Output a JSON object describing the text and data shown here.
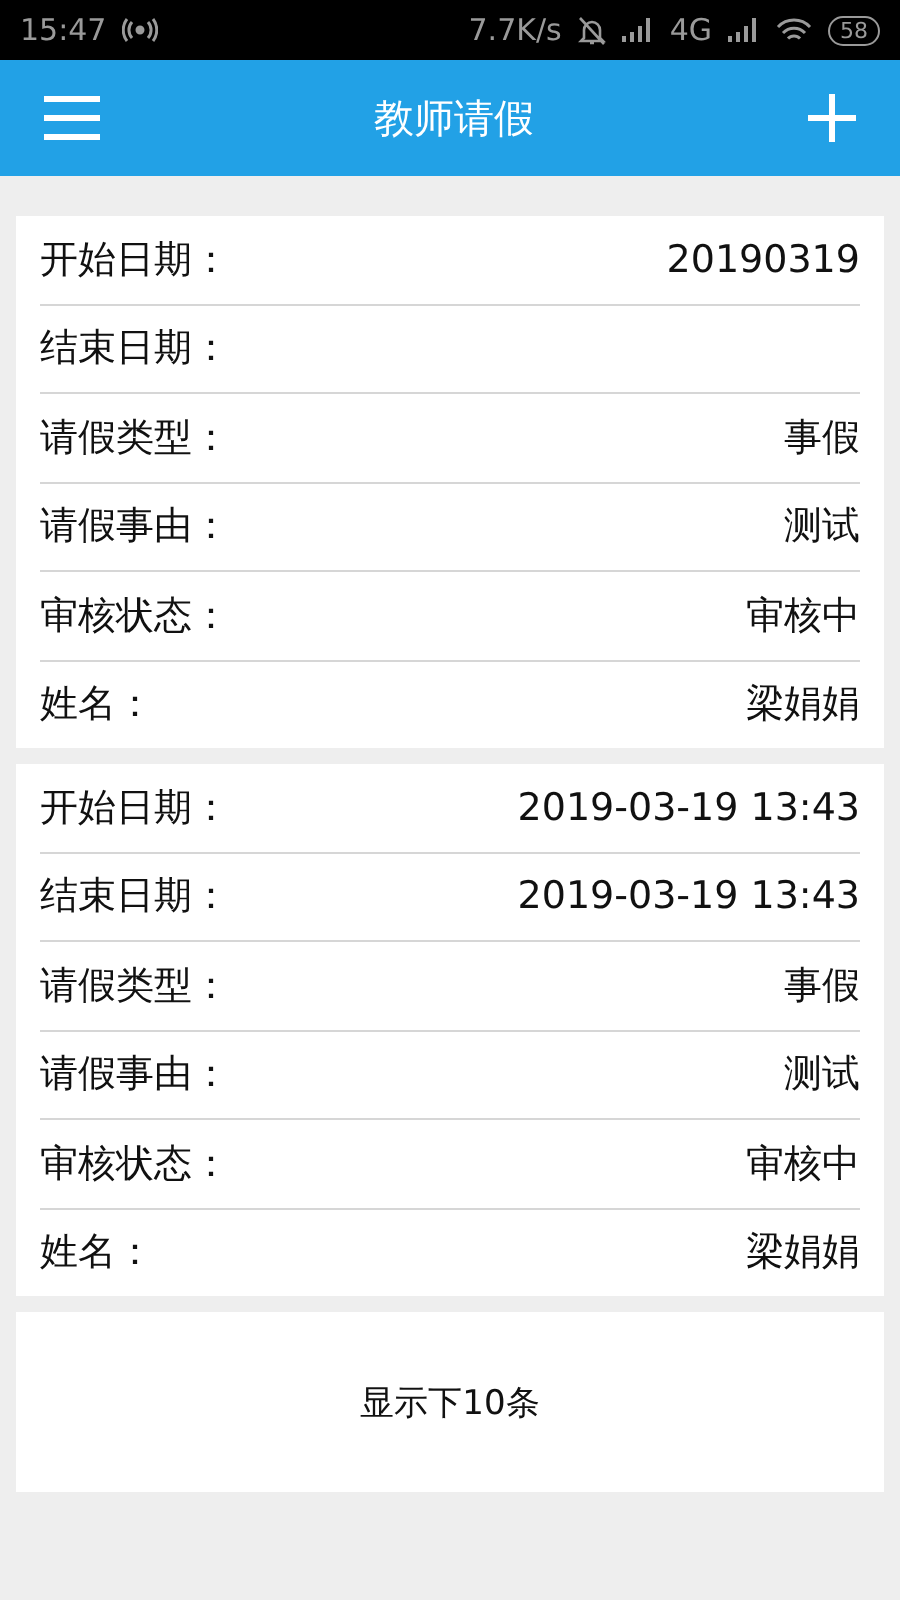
{
  "status_bar": {
    "time": "15:47",
    "speed": "7.7K/s",
    "network": "4G",
    "battery": "58"
  },
  "header": {
    "title": "教师请假"
  },
  "records": [
    {
      "fields": [
        {
          "label": "开始日期：",
          "value": "20190319"
        },
        {
          "label": "结束日期："
        },
        {
          "label": "请假类型：",
          "value": "事假"
        },
        {
          "label": "请假事由：",
          "value": "测试"
        },
        {
          "label": "审核状态：",
          "value": "审核中"
        },
        {
          "label": "姓名：",
          "value": "梁娟娟"
        }
      ]
    },
    {
      "fields": [
        {
          "label": "开始日期：",
          "value": "2019-03-19 13:43"
        },
        {
          "label": "结束日期：",
          "value": "2019-03-19 13:43"
        },
        {
          "label": "请假类型：",
          "value": "事假"
        },
        {
          "label": "请假事由：",
          "value": "测试"
        },
        {
          "label": "审核状态：",
          "value": "审核中"
        },
        {
          "label": "姓名：",
          "value": "梁娟娟"
        }
      ]
    }
  ],
  "load_more": "显示下10条"
}
